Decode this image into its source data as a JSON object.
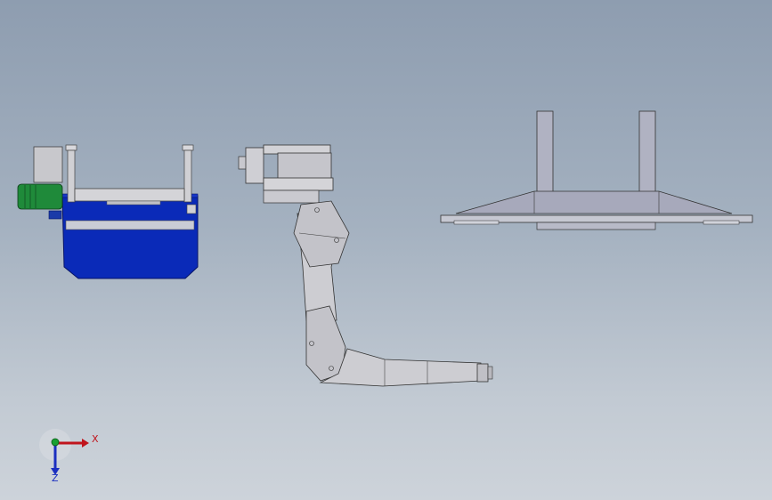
{
  "viewport": {
    "background_top": "#8e9db0",
    "background_bottom": "#cdd3da"
  },
  "models": {
    "conveyor": {
      "name": "tank-conveyor-assembly",
      "tank_color": "#0a2ab8",
      "motor_color": "#1f8a3a"
    },
    "robot_arm": {
      "name": "articulated-robot-arm",
      "body_color": "#c9c9cf"
    },
    "base_frame": {
      "name": "robot-base-frame",
      "body_color": "#b4b6c4"
    }
  },
  "triad": {
    "x_label": "X",
    "z_label": "Z",
    "x_color": "#c0141c",
    "y_color": "#18a030",
    "z_color": "#1b2fc0"
  }
}
